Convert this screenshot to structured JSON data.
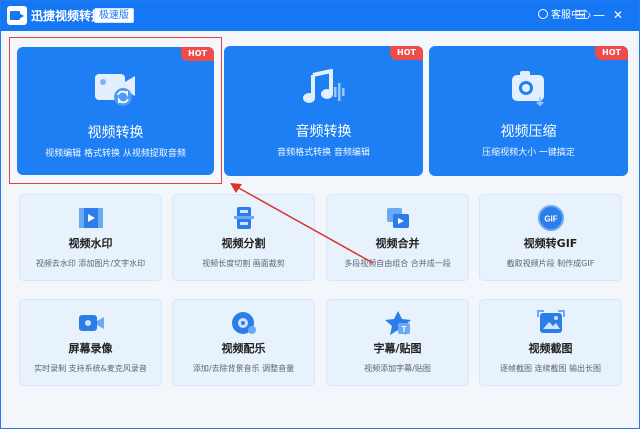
{
  "titlebar": {
    "app_title": "迅捷视频转换器",
    "edition": "极速版",
    "support": "客服中心",
    "menu_glyph": "☰",
    "min_glyph": "—",
    "close_glyph": "✕"
  },
  "hot_label": "HOT",
  "big_cards": [
    {
      "title": "视频转换",
      "subtitle": "视频编辑 格式转换 从视频提取音频",
      "icon": "video-convert-icon"
    },
    {
      "title": "音频转换",
      "subtitle": "音频格式转换 音频编辑",
      "icon": "audio-convert-icon"
    },
    {
      "title": "视频压缩",
      "subtitle": "压缩视频大小 一键搞定",
      "icon": "video-compress-icon"
    }
  ],
  "small_cards": [
    {
      "title": "视频水印",
      "subtitle": "视频去水印 添加图片/文字水印",
      "icon": "watermark-icon"
    },
    {
      "title": "视频分割",
      "subtitle": "视频长度切割 画面裁剪",
      "icon": "split-icon"
    },
    {
      "title": "视频合并",
      "subtitle": "多段视频自由组合 合并成一段",
      "icon": "merge-icon"
    },
    {
      "title": "视频转GIF",
      "subtitle": "截取视频片段 制作成GIF",
      "icon": "gif-icon"
    },
    {
      "title": "屏幕录像",
      "subtitle": "实时录制 支持系统&麦克风录音",
      "icon": "screen-record-icon"
    },
    {
      "title": "视频配乐",
      "subtitle": "添加/去除背景音乐 调整音量",
      "icon": "music-icon"
    },
    {
      "title": "字幕/贴图",
      "subtitle": "视频添加字幕/贴图",
      "icon": "subtitle-icon"
    },
    {
      "title": "视频截图",
      "subtitle": "逐帧截图 连续截图 输出长图",
      "icon": "screenshot-icon"
    }
  ],
  "colors": {
    "primary": "#1677f5",
    "card_blue": "#1d7ff3",
    "hot_red": "#f04b4b",
    "annotation_red": "#e4403c",
    "small_card_bg": "#e8f2fd"
  }
}
